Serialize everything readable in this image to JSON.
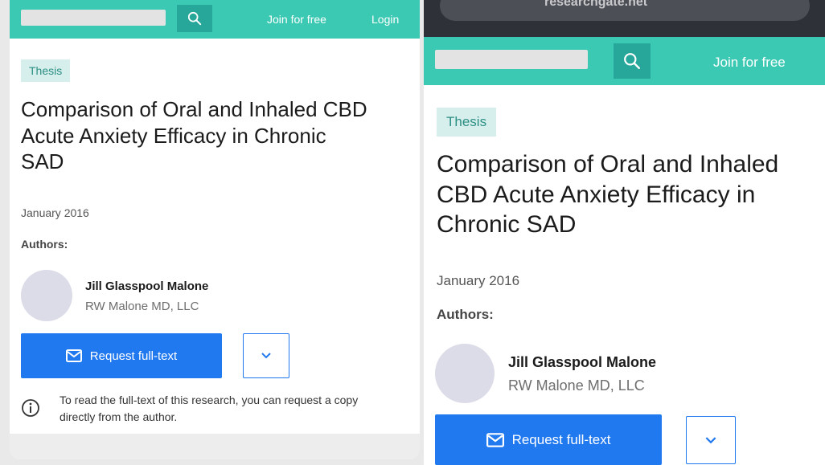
{
  "left": {
    "topbar": {
      "join_label": "Join for free",
      "login_label": "Login"
    },
    "badge": "Thesis",
    "title": "Comparison of Oral and Inhaled CBD Acute Anxiety Efficacy in Chronic SAD",
    "date": "January 2016",
    "authors_label": "Authors:",
    "author": {
      "name": "Jill Glasspool Malone",
      "affiliation": "RW Malone MD, LLC"
    },
    "request_label": "Request full-text",
    "info_text": "To read the full-text of this research, you can request a copy directly from the author."
  },
  "right": {
    "url_text": "researchgate.net",
    "topbar": {
      "join_label": "Join for free"
    },
    "badge": "Thesis",
    "title": "Comparison of Oral and Inhaled CBD Acute Anxiety Efficacy in Chronic SAD",
    "date": "January 2016",
    "authors_label": "Authors:",
    "author": {
      "name": "Jill Glasspool Malone",
      "affiliation": "RW Malone MD, LLC"
    },
    "request_label": "Request full-text"
  },
  "colors": {
    "brand_teal": "#3cc9b4",
    "search_btn": "#26a79a",
    "primary_blue": "#2179f0",
    "badge_bg": "#d6efec"
  },
  "icons": {
    "search": "search-icon",
    "mail": "mail-icon",
    "chevron": "chevron-down-icon",
    "info": "info-icon"
  }
}
